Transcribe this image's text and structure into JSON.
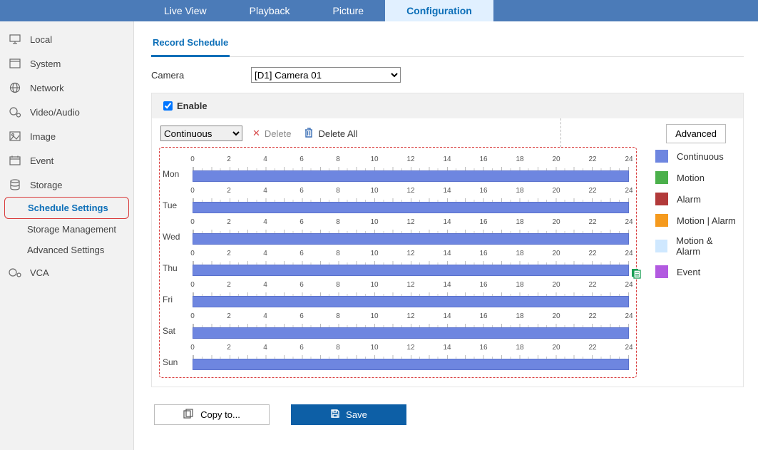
{
  "topnav": {
    "items": [
      "Live View",
      "Playback",
      "Picture",
      "Configuration"
    ],
    "active": 3
  },
  "sidebar": {
    "items": [
      {
        "label": "Local",
        "icon": "monitor"
      },
      {
        "label": "System",
        "icon": "window"
      },
      {
        "label": "Network",
        "icon": "globe"
      },
      {
        "label": "Video/Audio",
        "icon": "camera"
      },
      {
        "label": "Image",
        "icon": "image"
      },
      {
        "label": "Event",
        "icon": "calendar"
      },
      {
        "label": "Storage",
        "icon": "storage"
      }
    ],
    "sub": [
      {
        "label": "Schedule Settings",
        "active": true
      },
      {
        "label": "Storage Management",
        "active": false
      },
      {
        "label": "Advanced Settings",
        "active": false
      }
    ],
    "after": [
      {
        "label": "VCA",
        "icon": "vca"
      }
    ]
  },
  "tab": {
    "label": "Record Schedule"
  },
  "camera": {
    "label": "Camera",
    "selected": "[D1] Camera 01"
  },
  "enable": {
    "label": "Enable",
    "checked": true
  },
  "toolbar": {
    "mode": "Continuous",
    "delete": "Delete",
    "delete_all": "Delete All",
    "advanced": "Advanced"
  },
  "legend": [
    {
      "label": "Continuous",
      "color": "#6e86e0"
    },
    {
      "label": "Motion",
      "color": "#4bb04b"
    },
    {
      "label": "Alarm",
      "color": "#b23a3a"
    },
    {
      "label": "Motion | Alarm",
      "color": "#f59a1e"
    },
    {
      "label": "Motion & Alarm",
      "color": "#cfe8ff"
    },
    {
      "label": "Event",
      "color": "#b25ae0"
    }
  ],
  "schedule": {
    "days": [
      "Mon",
      "Tue",
      "Wed",
      "Thu",
      "Fri",
      "Sat",
      "Sun"
    ],
    "hours": [
      0,
      2,
      4,
      6,
      8,
      10,
      12,
      14,
      16,
      18,
      20,
      22,
      24
    ],
    "bars": [
      {
        "start": 0,
        "end": 24
      },
      {
        "start": 0,
        "end": 24
      },
      {
        "start": 0,
        "end": 24
      },
      {
        "start": 0,
        "end": 24
      },
      {
        "start": 0,
        "end": 24
      },
      {
        "start": 0,
        "end": 24
      },
      {
        "start": 0,
        "end": 24
      }
    ]
  },
  "footer": {
    "copy": "Copy to...",
    "save": "Save"
  }
}
